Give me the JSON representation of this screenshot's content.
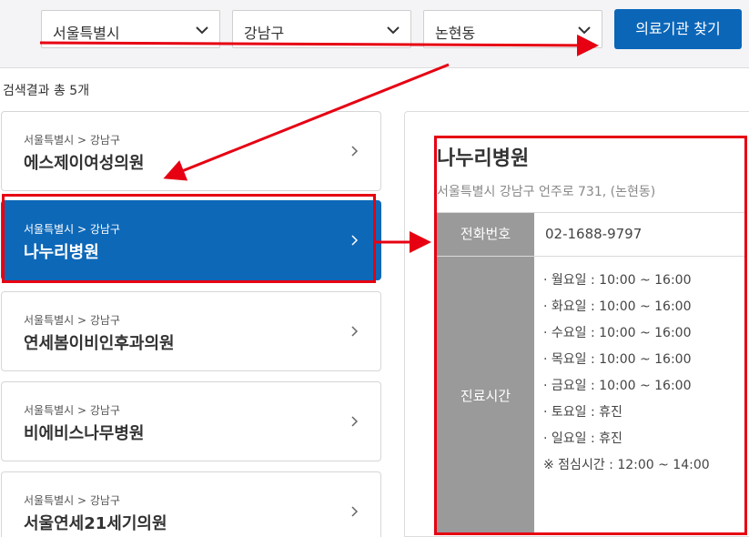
{
  "search": {
    "sido": "서울특별시",
    "sigungu": "강남구",
    "dong": "논현동",
    "button_label": "의료기관 찾기"
  },
  "result_count": "검색결과 총 5개",
  "list": [
    {
      "path": "서울특별시 > 강남구",
      "name": "에스제이여성의원"
    },
    {
      "path": "서울특별시 > 강남구",
      "name": "나누리병원"
    },
    {
      "path": "서울특별시 > 강남구",
      "name": "연세봄이비인후과의원"
    },
    {
      "path": "서울특별시 > 강남구",
      "name": "비에비스나무병원"
    },
    {
      "path": "서울특별시 > 강남구",
      "name": "서울연세21세기의원"
    }
  ],
  "detail": {
    "name": "나누리병원",
    "address": "서울특별시 강남구 언주로 731, (논현동)",
    "phone_label": "전화번호",
    "phone": "02-1688-9797",
    "hours_label": "진료시간",
    "hours": [
      "· 월요일 : 10:00 ~ 16:00",
      "· 화요일 : 10:00 ~ 16:00",
      "· 수요일 : 10:00 ~ 16:00",
      "· 목요일 : 10:00 ~ 16:00",
      "· 금요일 : 10:00 ~ 16:00",
      "· 토요일 : 휴진",
      "· 일요일 : 휴진",
      "※ 점심시간 : 12:00 ~ 14:00"
    ]
  },
  "colors": {
    "accent": "#0b66b8",
    "annotation": "#e60012",
    "table_header": "#9a9a9a"
  },
  "icons": [
    "chevron-down-icon",
    "chevron-right-icon"
  ]
}
